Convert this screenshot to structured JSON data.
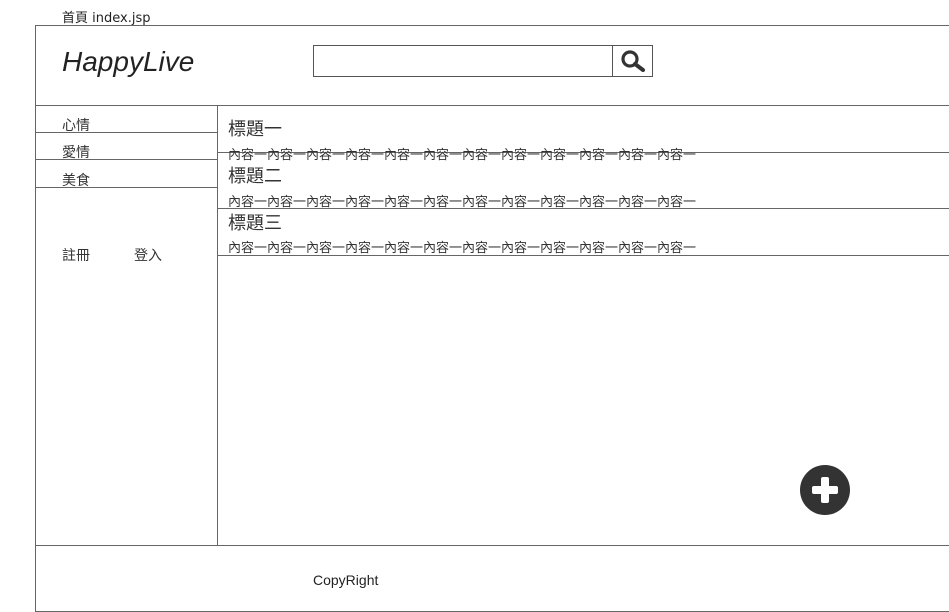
{
  "page": {
    "label": "首頁 index.jsp"
  },
  "header": {
    "logo": "HappyLive",
    "search": {
      "value": "",
      "placeholder": ""
    },
    "search_icon": "search-icon"
  },
  "sidebar": {
    "items": [
      {
        "label": "心情"
      },
      {
        "label": "愛情"
      },
      {
        "label": "美食"
      }
    ],
    "register_label": "註冊",
    "login_label": "登入"
  },
  "posts": [
    {
      "title": "標題一",
      "body": "內容一內容一內容一內容一內容一內容一內容一內容一內容一內容一內容一內容一"
    },
    {
      "title": "標題二",
      "body": "內容一內容一內容一內容一內容一內容一內容一內容一內容一內容一內容一內容一"
    },
    {
      "title": "標題三",
      "body": "內容一內容一內容一內容一內容一內容一內容一內容一內容一內容一內容一內容一"
    }
  ],
  "add_icon": "plus-circle-icon",
  "footer": {
    "copyright": "CopyRight"
  }
}
